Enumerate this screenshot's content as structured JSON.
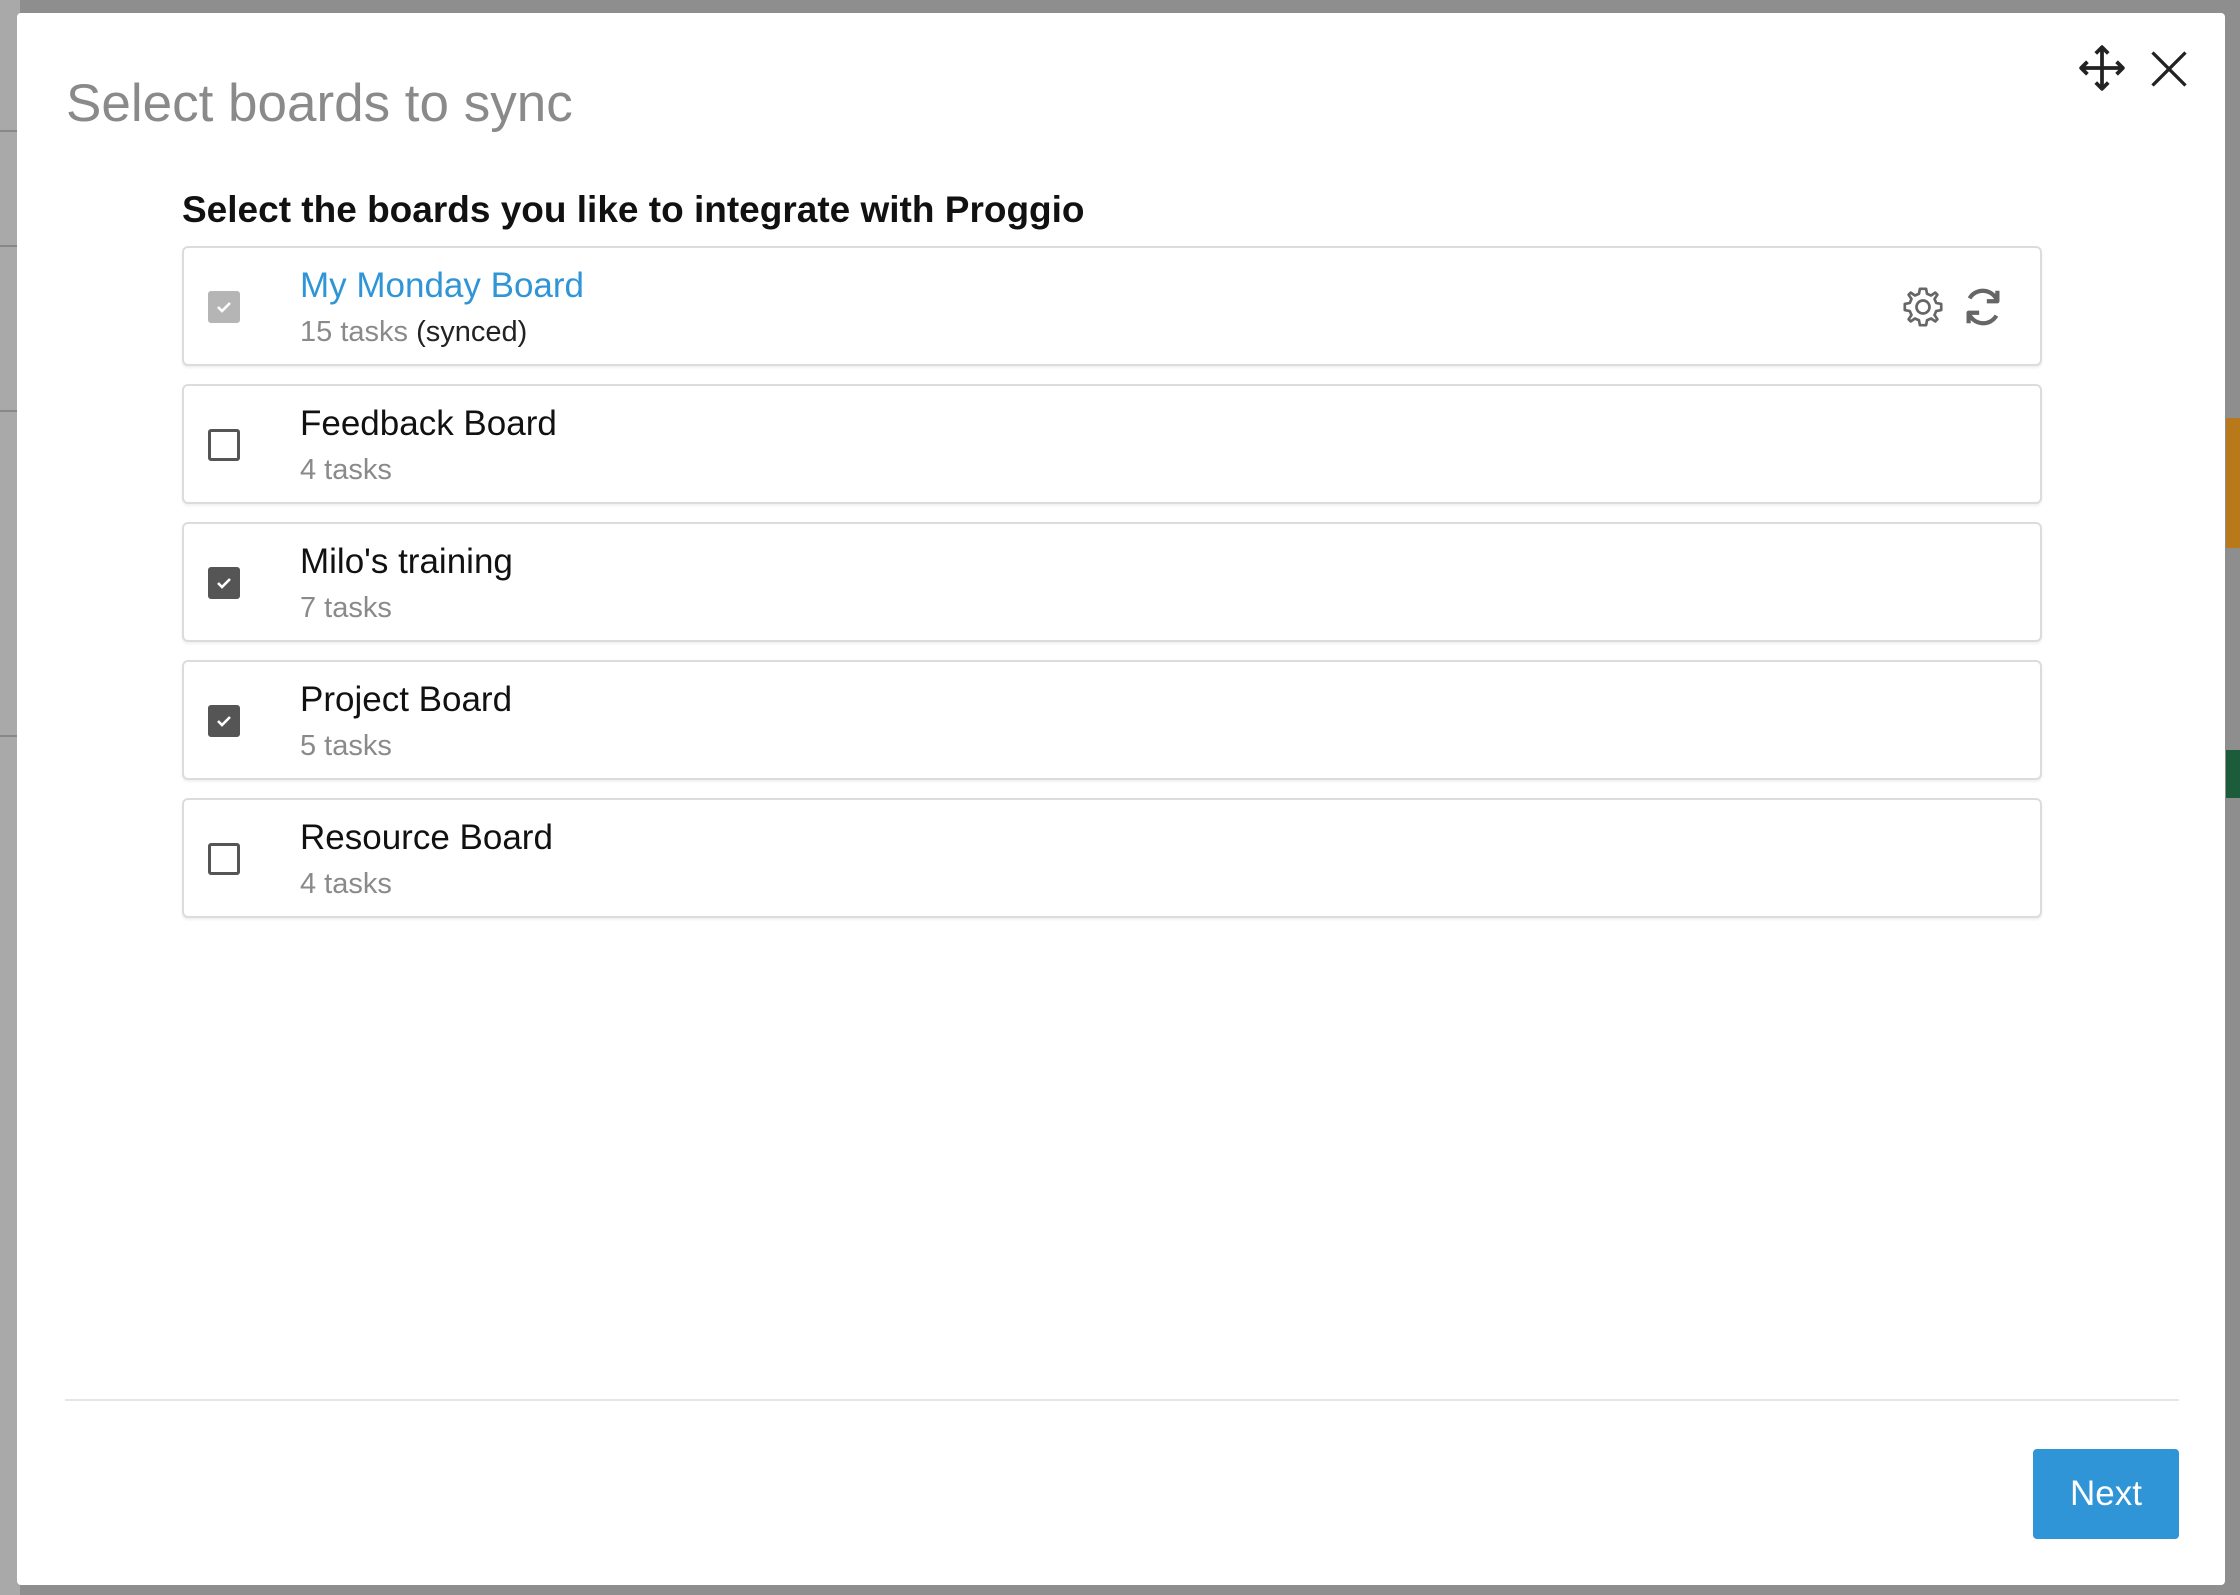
{
  "dialog": {
    "title": "Select boards to sync",
    "subtitle": "Select the boards you like to integrate with Proggio"
  },
  "boards": [
    {
      "name": "My Monday Board",
      "tasks": "15 tasks",
      "status": "(synced)",
      "checked": true,
      "disabled": true
    },
    {
      "name": "Feedback Board",
      "tasks": "4 tasks",
      "checked": false
    },
    {
      "name": "Milo's training",
      "tasks": "7 tasks",
      "checked": true
    },
    {
      "name": "Project Board",
      "tasks": "5 tasks",
      "checked": true
    },
    {
      "name": "Resource Board",
      "tasks": "4 tasks",
      "checked": false
    }
  ],
  "footer": {
    "next_label": "Next"
  },
  "colors": {
    "accent": "#2f95d6",
    "checkbox": "#555555",
    "disabled_checkbox": "#b5b5b5"
  },
  "icons": [
    "move-icon",
    "close-icon",
    "gear-icon",
    "sync-icon",
    "check-icon"
  ]
}
